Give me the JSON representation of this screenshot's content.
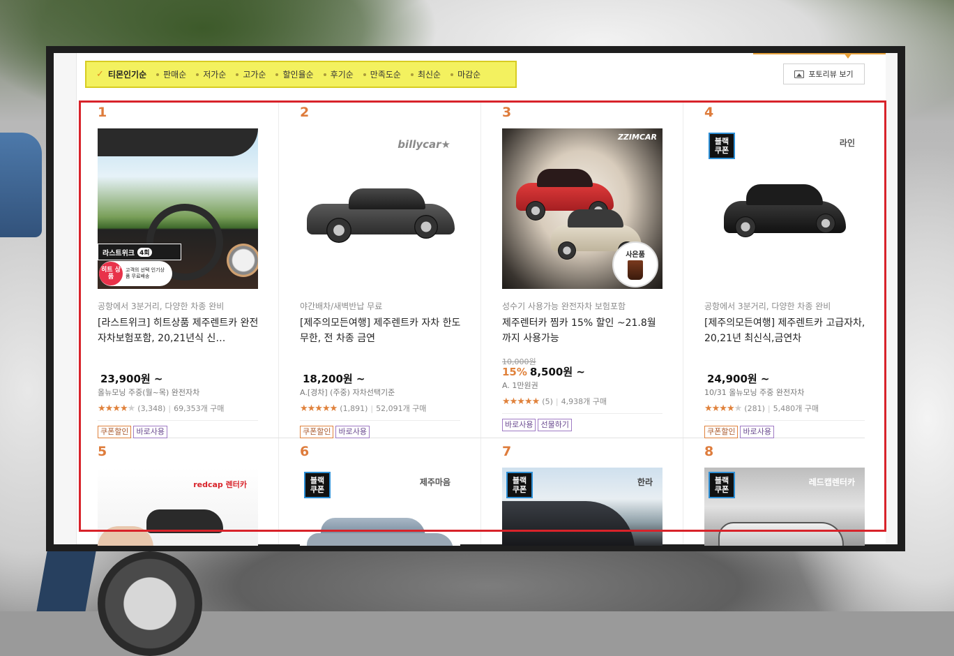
{
  "sort_bar": {
    "items": [
      {
        "label": "티몬인기순",
        "active": true
      },
      {
        "label": "판매순",
        "active": false
      },
      {
        "label": "저가순",
        "active": false
      },
      {
        "label": "고가순",
        "active": false
      },
      {
        "label": "할인율순",
        "active": false
      },
      {
        "label": "후기순",
        "active": false
      },
      {
        "label": "만족도순",
        "active": false
      },
      {
        "label": "최신순",
        "active": false
      },
      {
        "label": "마감순",
        "active": false
      }
    ]
  },
  "photo_review_button": "포토리뷰 보기",
  "products": [
    {
      "rank": "1",
      "thumb_badge": "라스트위크",
      "thumb_badge_count": "4회",
      "thumb_circle": "히트 상품",
      "thumb_note": "고객의 선택 인기상품 무료배송",
      "subtitle": "공항에서 3분거리, 다양한 차종 완비",
      "title": "[라스트위크] 히트상품 제주렌트카 완전자차보험포함, 20,21년식 신…",
      "old_price": "",
      "discount": "",
      "price": "23,900원 ~",
      "price_sub": "올뉴모닝 주중(월~목) 완전자차",
      "rating_value": 4.5,
      "review_count": "(3,348)",
      "purchase": "69,353개 구매",
      "tags": [
        {
          "label": "쿠폰할인",
          "kind": "coupon"
        },
        {
          "label": "바로사용",
          "kind": "purple"
        }
      ]
    },
    {
      "rank": "2",
      "brand": "billycar★",
      "subtitle": "야간배차/새벽반납 무료",
      "title": "[제주의모든여행] 제주렌트카 자차 한도무한, 전 차종 금연",
      "old_price": "",
      "discount": "",
      "price": "18,200원 ~",
      "price_sub": "A.[경차] (주중) 자차선택기준",
      "rating_value": 5,
      "review_count": "(1,891)",
      "purchase": "52,091개 구매",
      "tags": [
        {
          "label": "쿠폰할인",
          "kind": "coupon"
        },
        {
          "label": "바로사용",
          "kind": "purple"
        }
      ]
    },
    {
      "rank": "3",
      "brand": "ZZIMCAR",
      "thumb_gift": "사은품",
      "subtitle": "성수기 사용가능 완전자차 보험포함",
      "title": "제주렌터카 찜카 15% 할인 ~21.8월까지 사용가능",
      "old_price": "10,000원",
      "discount": "15%",
      "price": "8,500원 ~",
      "price_sub": "A. 1만원권",
      "rating_value": 4.5,
      "review_count": "(5)",
      "purchase": "4,938개 구매",
      "tags": [
        {
          "label": "바로사용",
          "kind": "purple"
        },
        {
          "label": "선물하기",
          "kind": "purple"
        }
      ]
    },
    {
      "rank": "4",
      "brand": "라인",
      "coupon_line1": "블랙",
      "coupon_line2": "쿠폰",
      "subtitle": "공항에서 3분거리, 다양한 차종 완비",
      "title": "[제주의모든여행] 제주렌트카 고급자차, 20,21년 최신식,금연차",
      "old_price": "",
      "discount": "",
      "price": "24,900원 ~",
      "price_sub": "10/31 올뉴모닝 주중 완전자차",
      "rating_value": 4,
      "review_count": "(281)",
      "purchase": "5,480개 구매",
      "tags": [
        {
          "label": "쿠폰할인",
          "kind": "coupon"
        },
        {
          "label": "바로사용",
          "kind": "purple"
        }
      ]
    },
    {
      "rank": "5",
      "brand": "redcap 렌터카"
    },
    {
      "rank": "6",
      "brand": "제주마음",
      "coupon_line1": "블랙",
      "coupon_line2": "쿠폰"
    },
    {
      "rank": "7",
      "brand": "한라",
      "coupon_line1": "블랙",
      "coupon_line2": "쿠폰"
    },
    {
      "rank": "8",
      "brand": "레드캡렌터카",
      "coupon_line1": "블랙",
      "coupon_line2": "쿠폰"
    }
  ],
  "colors": {
    "sort_bar_bg": "#f3f15f",
    "highlight_border": "#d8232a",
    "accent_orange": "#de7c3c",
    "tag_purple": "#9f7ac4"
  }
}
